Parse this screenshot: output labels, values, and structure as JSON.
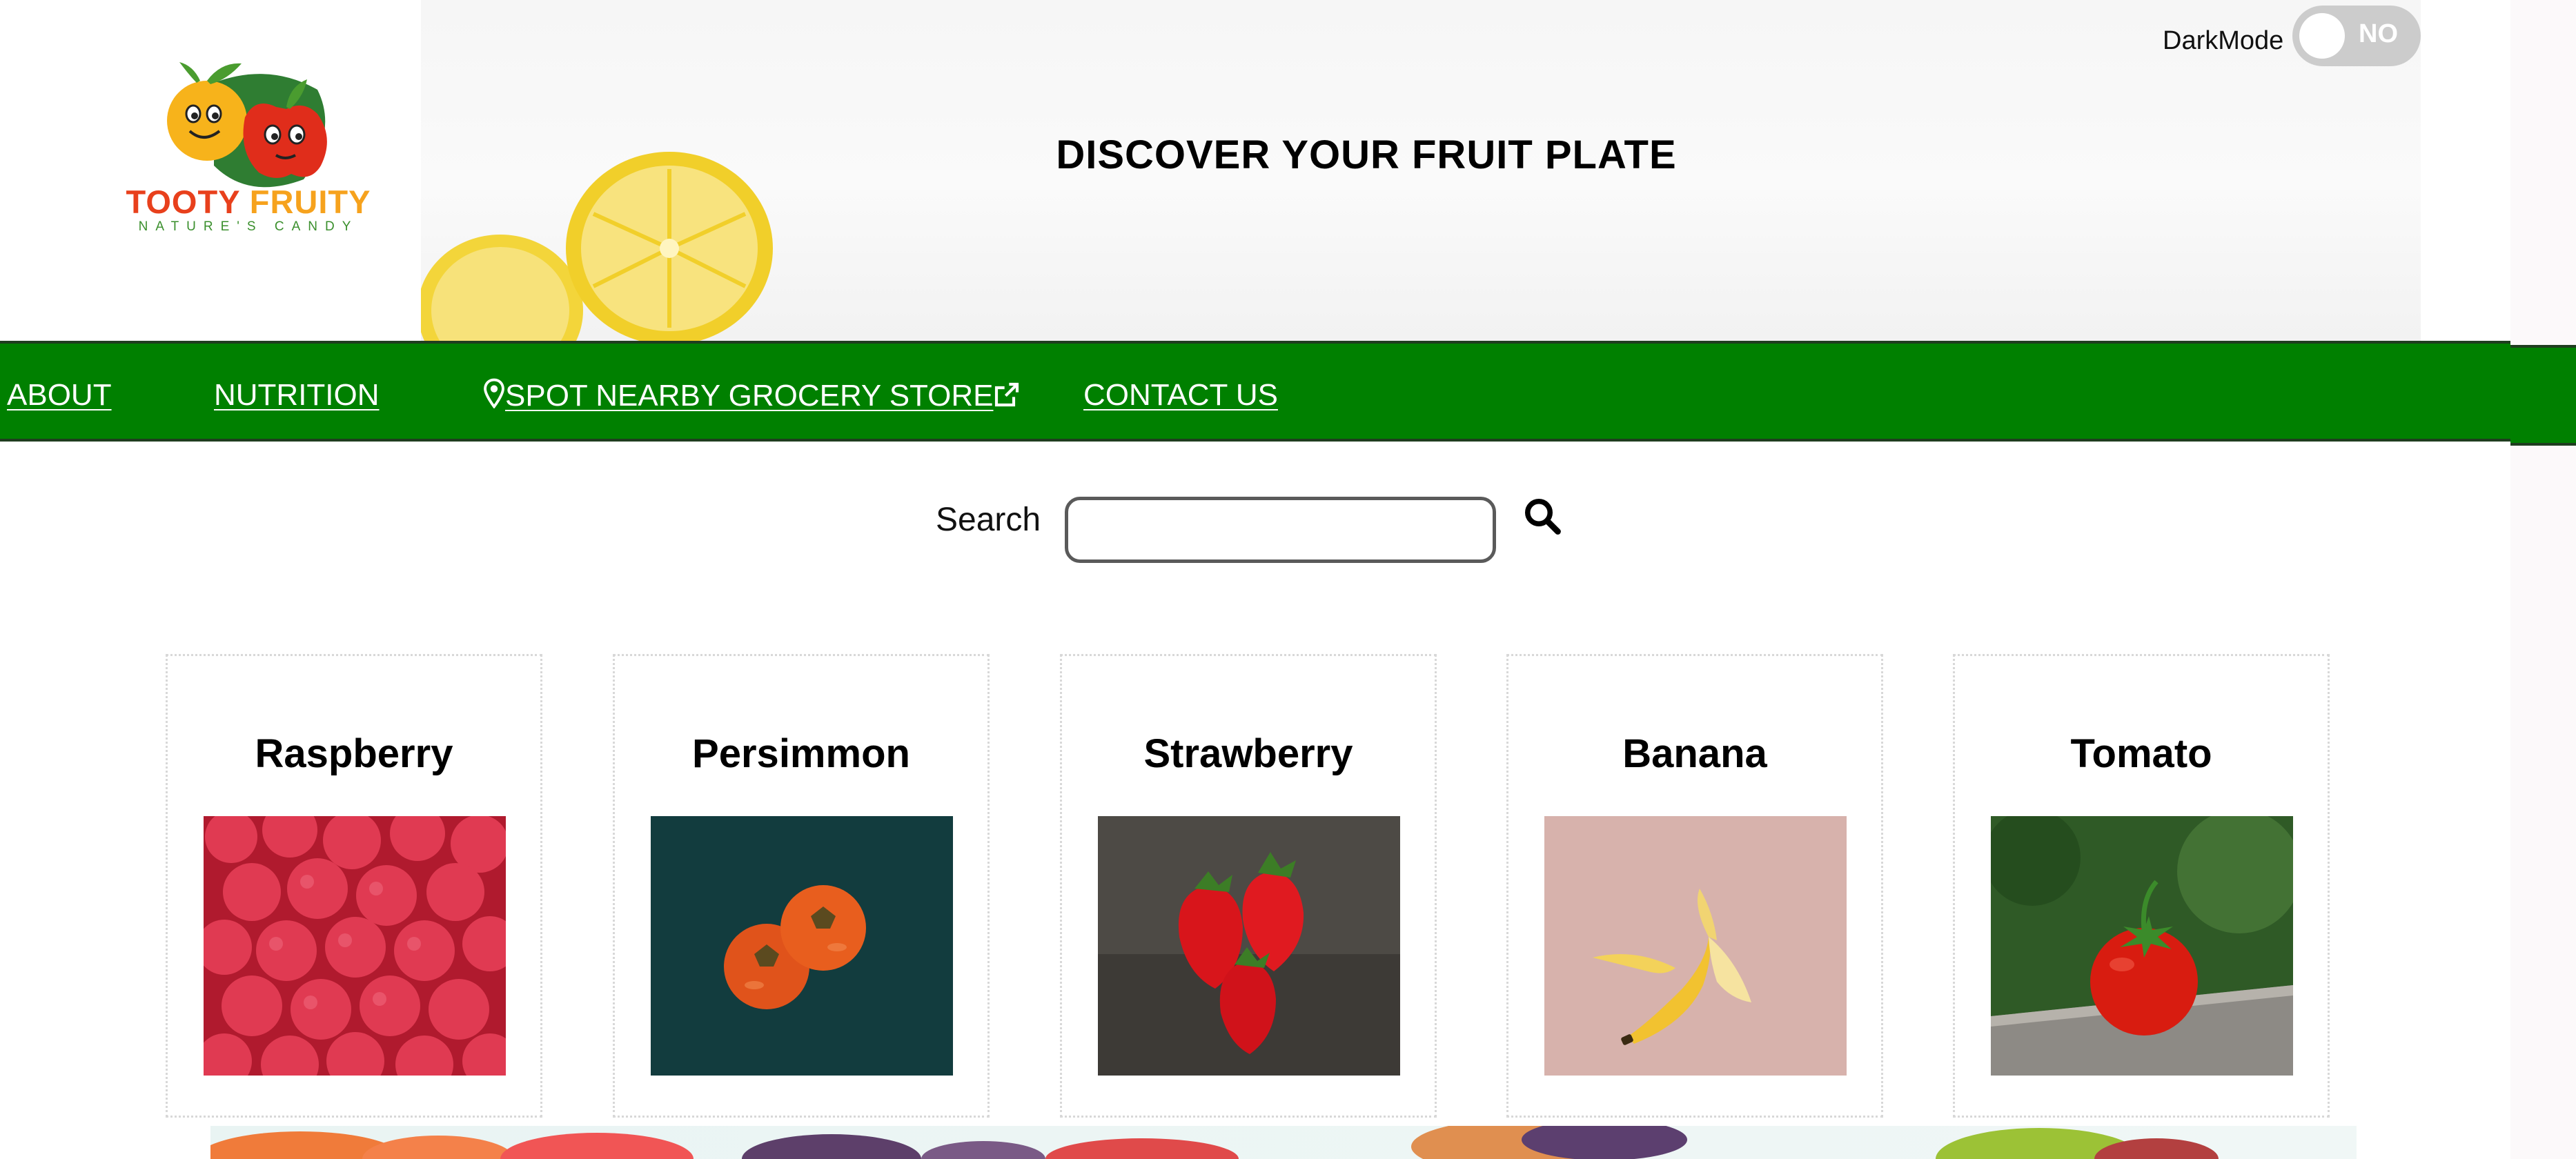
{
  "logo": {
    "brand_part1": "TOOTY ",
    "brand_part2": "FRUITY",
    "tagline": "NATURE'S CANDY"
  },
  "hero": {
    "title": "DISCOVER YOUR FRUIT PLATE"
  },
  "darkmode": {
    "label": "DarkMode",
    "state_text": "NO"
  },
  "nav": {
    "items": [
      {
        "label": "ABOUT"
      },
      {
        "label": "NUTRITION"
      },
      {
        "label": "SPOT NEARBY GROCERY STORE",
        "icon": "map-pin-icon",
        "trailing_icon": "external-link-icon"
      },
      {
        "label": "CONTACT US"
      }
    ]
  },
  "search": {
    "label": "Search",
    "value": "",
    "placeholder": "",
    "button_icon": "search-icon"
  },
  "fruits": [
    {
      "name": "Raspberry"
    },
    {
      "name": "Persimmon"
    },
    {
      "name": "Strawberry"
    },
    {
      "name": "Banana"
    },
    {
      "name": "Tomato"
    }
  ],
  "colors": {
    "nav_green": "#008000",
    "toggle_off": "#cccccc",
    "brand_red": "#e8401c",
    "brand_orange": "#f6a21d",
    "brand_green": "#3a8f2c"
  }
}
